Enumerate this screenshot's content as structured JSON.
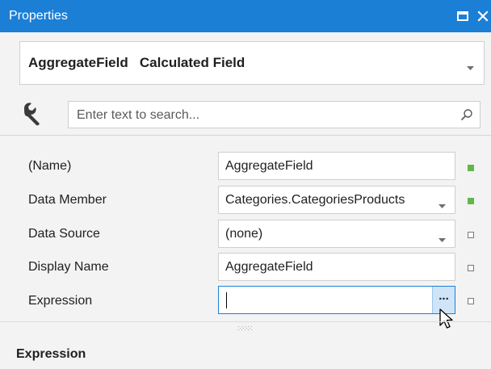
{
  "window": {
    "title": "Properties",
    "accent_color": "#1c7fd6"
  },
  "titlebar": {
    "maximize_icon": "maximize-icon",
    "close_icon": "close-icon"
  },
  "object_selector": {
    "name": "AggregateField",
    "type": "Calculated Field",
    "display": "AggregateField   Calculated Field"
  },
  "search": {
    "placeholder": "Enter text to search...",
    "value": ""
  },
  "properties": [
    {
      "label": "(Name)",
      "value": "AggregateField",
      "editor": "text",
      "status": "modified"
    },
    {
      "label": "Data Member",
      "value": "Categories.CategoriesProducts",
      "editor": "combo",
      "status": "modified"
    },
    {
      "label": "Data Source",
      "value": "(none)",
      "editor": "combo",
      "status": "default"
    },
    {
      "label": "Display Name",
      "value": "AggregateField",
      "editor": "text",
      "status": "default"
    },
    {
      "label": "Expression",
      "value": "",
      "editor": "ellipsis",
      "status": "default"
    }
  ],
  "expression_editor": {
    "ellipsis_label": "..."
  },
  "description": {
    "title": "Expression"
  },
  "status_colors": {
    "modified": "#5fb84b",
    "default": "#ffffff"
  }
}
